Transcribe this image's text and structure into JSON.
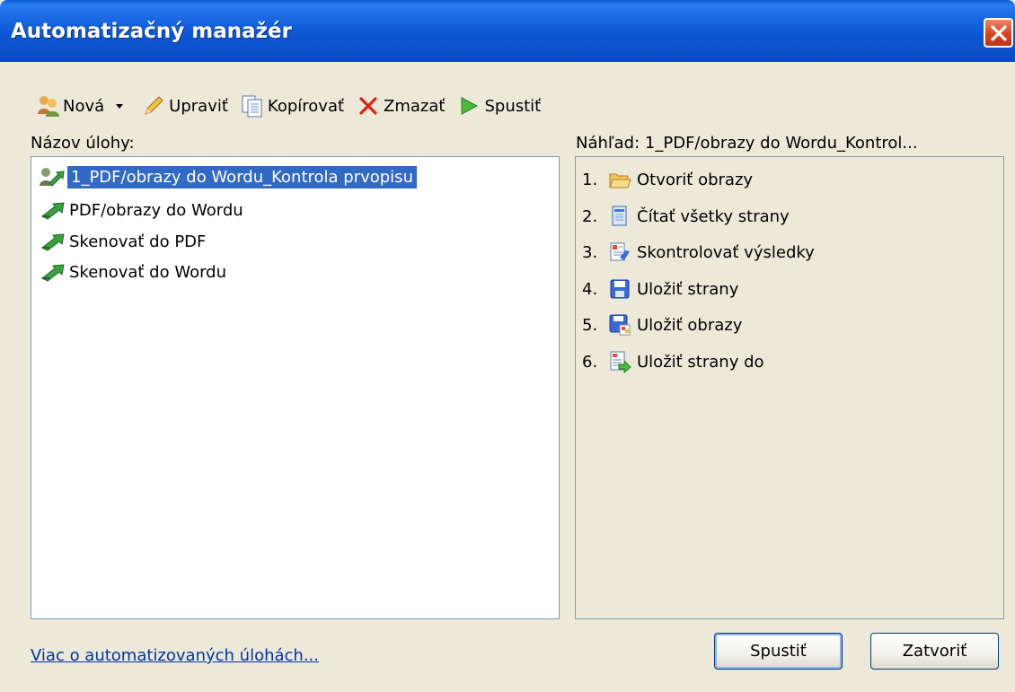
{
  "window": {
    "title": "Automatizačný manažér"
  },
  "toolbar": {
    "new_label": "Nová",
    "edit_label": "Upraviť",
    "copy_label": "Kopírovať",
    "delete_label": "Zmazať",
    "run_label": "Spustiť"
  },
  "left_panel": {
    "label": "Názov úlohy:",
    "tasks": [
      {
        "label": "1_PDF/obrazy do Wordu_Kontrola prvopisu",
        "icon": "custom-task-icon",
        "selected": true
      },
      {
        "label": "PDF/obrazy do Wordu",
        "icon": "quick-task-icon"
      },
      {
        "label": "Skenovať do PDF",
        "icon": "quick-task-icon"
      },
      {
        "label": "Skenovať do Wordu",
        "icon": "quick-task-icon"
      }
    ]
  },
  "right_panel": {
    "label": "Náhľad: 1_PDF/obrazy do Wordu_Kontrol...",
    "steps": [
      {
        "num": "1.",
        "label": "Otvoriť obrazy",
        "icon": "open-images-icon"
      },
      {
        "num": "2.",
        "label": "Čítať všetky strany",
        "icon": "read-pages-icon"
      },
      {
        "num": "3.",
        "label": "Skontrolovať výsledky",
        "icon": "check-results-icon"
      },
      {
        "num": "4.",
        "label": "Uložiť strany",
        "icon": "save-pages-icon"
      },
      {
        "num": "5.",
        "label": "Uložiť obrazy",
        "icon": "save-images-icon"
      },
      {
        "num": "6.",
        "label": "Uložiť strany do",
        "icon": "save-pages-to-icon"
      }
    ]
  },
  "footer": {
    "link": "Viac o automatizovaných úlohách...",
    "run_button": "Spustiť",
    "close_button": "Zatvoriť"
  }
}
